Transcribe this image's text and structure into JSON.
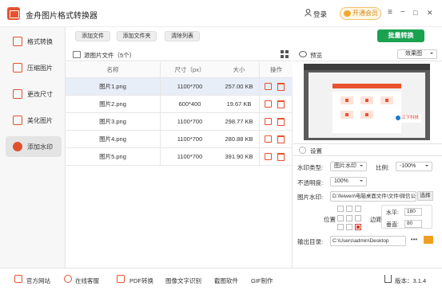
{
  "app": {
    "title": "金舟图片格式转换器",
    "login": "登录",
    "vip": "开通会员",
    "window_controls": [
      "≡",
      "−",
      "□",
      "✕"
    ]
  },
  "sidebar": {
    "items": [
      {
        "label": "格式转换",
        "icon": "format-convert-icon",
        "active": false
      },
      {
        "label": "压缩图片",
        "icon": "compress-icon",
        "active": false
      },
      {
        "label": "更改尺寸",
        "icon": "resize-icon",
        "active": false
      },
      {
        "label": "美化图片",
        "icon": "beautify-icon",
        "active": false
      },
      {
        "label": "添加水印",
        "icon": "watermark-icon",
        "active": true
      }
    ]
  },
  "toolbar": {
    "add_file": "添加文件",
    "add_folder": "添加文件夹",
    "clear_list": "清除列表",
    "batch_convert": "批量转换"
  },
  "file_list": {
    "title": "源图片文件（5个）",
    "columns": [
      "名称",
      "尺寸（px）",
      "大小",
      "操作"
    ],
    "rows": [
      {
        "name": "图片1.png",
        "dims": "1100*700",
        "size": "257.00 KB",
        "selected": true
      },
      {
        "name": "图片2.png",
        "dims": "600*400",
        "size": "19.67 KB",
        "selected": false
      },
      {
        "name": "图片3.png",
        "dims": "1100*700",
        "size": "298.77 KB",
        "selected": false
      },
      {
        "name": "图片4.png",
        "dims": "1100*700",
        "size": "280.88 KB",
        "selected": false
      },
      {
        "name": "图片5.png",
        "dims": "1100*700",
        "size": "391.90 KB",
        "selected": false
      }
    ]
  },
  "preview": {
    "title": "预览",
    "mode_select": "效果图",
    "watermark_text": "江下科技"
  },
  "settings": {
    "title": "设置",
    "watermark_type_label": "水印类型:",
    "watermark_type_value": "图片水印",
    "ratio_label": "比例:",
    "ratio_value": "-100%",
    "opacity_label": "不透明度:",
    "opacity_value": "100%",
    "image_watermark_label": "图片水印:",
    "image_watermark_path": "D:\\feiwen\\电脑桌面文件\\文件\\微信公众号",
    "choose_button": "选择",
    "position_label": "位置",
    "offset_label": "边距",
    "horizontal_label": "水平:",
    "horizontal_value": "180",
    "vertical_label": "垂直:",
    "vertical_value": "80",
    "output_label": "输出目录:",
    "output_path": "C:\\Users\\admin\\Desktop",
    "more_button": "•••"
  },
  "footer": {
    "items": [
      "官方网站",
      "在线客服",
      "PDF转换",
      "图像文字识别",
      "截图软件",
      "GIF制作"
    ],
    "version": "版本：3.1.4"
  },
  "colors": {
    "accent": "#e8522e",
    "primary_button": "#1aa251",
    "selected_row": "#e8eef8"
  }
}
